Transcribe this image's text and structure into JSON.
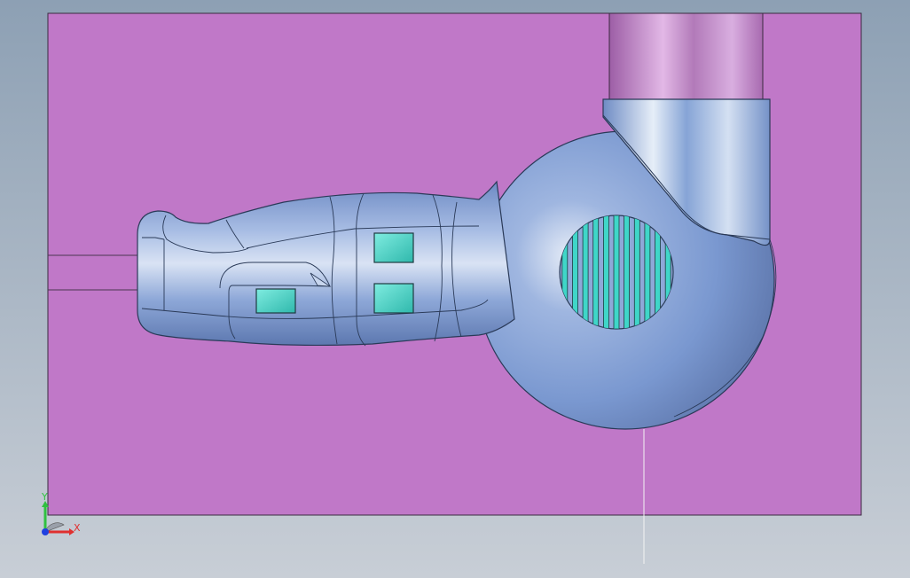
{
  "viewport": {
    "background_top": "#8da0b4",
    "background_bottom": "#c8ced6"
  },
  "mold_plate": {
    "color": "#c078c8",
    "edge_color": "#3a2a40"
  },
  "part": {
    "body_color": "#7e9cd2",
    "highlight_color": "#dfe7f4",
    "edge_color": "#2a3a58",
    "insert_color": "#3fd6c8",
    "pipe_color": "#b57ab8",
    "grille_slot_count": 11
  },
  "triad": {
    "x_label": "X",
    "y_label": "Y",
    "x_color": "#e03030",
    "y_color": "#30c040",
    "z_color": "#2040e0"
  }
}
